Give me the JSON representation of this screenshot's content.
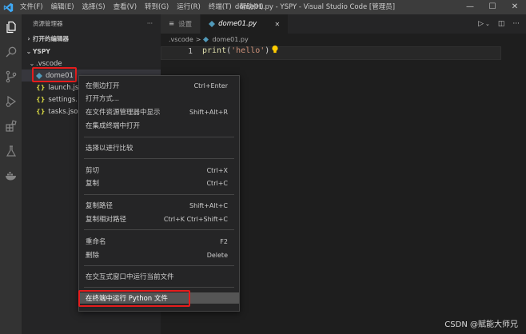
{
  "titlebar": {
    "menu": [
      "文件(F)",
      "编辑(E)",
      "选择(S)",
      "查看(V)",
      "转到(G)",
      "运行(R)",
      "终端(T)",
      "帮助(H)"
    ],
    "title": "dome01.py - YSPY - Visual Studio Code [管理员]",
    "controls": [
      "—",
      "☐",
      "✕"
    ]
  },
  "activitybar": {
    "icons": [
      "files-icon",
      "search-icon",
      "source-control-icon",
      "run-debug-icon",
      "extensions-icon",
      "testing-icon",
      "docker-icon"
    ]
  },
  "sidebar": {
    "header": "资源管理器",
    "more": "···",
    "open_editors": "打开的编辑器",
    "workspace": "YSPY",
    "tree": {
      "folder": ".vscode",
      "files": [
        {
          "name": "dome01",
          "icon": "python-icon"
        },
        {
          "name": "launch.js",
          "icon": "json-icon"
        },
        {
          "name": "settings.",
          "icon": "json-icon"
        },
        {
          "name": "tasks.jso",
          "icon": "json-icon"
        }
      ]
    }
  },
  "tabs": [
    {
      "label": "设置",
      "icon": "settings-list-icon",
      "active": false
    },
    {
      "label": "dome01.py",
      "icon": "python-icon",
      "active": true,
      "close": "✕"
    }
  ],
  "breadcrumb": {
    "folder": ".vscode",
    "sep": ">",
    "file": "dome01.py"
  },
  "editor": {
    "line_number": "1",
    "code": {
      "fn": "print",
      "open": "(",
      "str": "'hello'",
      "close": ")"
    }
  },
  "context_menu": {
    "items": [
      {
        "label": "在侧边打开",
        "shortcut": "Ctrl+Enter"
      },
      {
        "label": "打开方式...",
        "shortcut": ""
      },
      {
        "label": "在文件资源管理器中显示",
        "shortcut": "Shift+Alt+R"
      },
      {
        "label": "在集成终端中打开",
        "shortcut": ""
      },
      {
        "label": "选择以进行比较",
        "shortcut": ""
      },
      {
        "label": "剪切",
        "shortcut": "Ctrl+X"
      },
      {
        "label": "复制",
        "shortcut": "Ctrl+C"
      },
      {
        "label": "复制路径",
        "shortcut": "Shift+Alt+C"
      },
      {
        "label": "复制相对路径",
        "shortcut": "Ctrl+K Ctrl+Shift+C"
      },
      {
        "label": "重命名",
        "shortcut": "F2"
      },
      {
        "label": "删除",
        "shortcut": "Delete"
      },
      {
        "label": "在交互式窗口中运行当前文件",
        "shortcut": ""
      },
      {
        "label": "在终端中运行 Python 文件",
        "shortcut": ""
      }
    ]
  },
  "watermark": "CSDN @赋能大师兄",
  "colors": {
    "annotation": "#e51d1d",
    "accent": "#007acc"
  }
}
